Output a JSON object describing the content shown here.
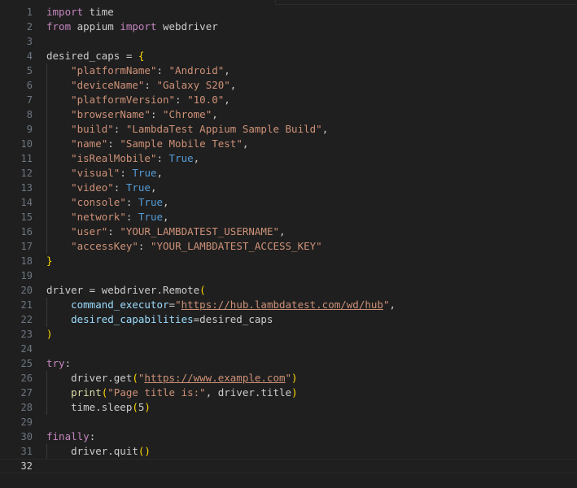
{
  "editor": {
    "current_line": 32,
    "lines": [
      {
        "n": "1",
        "tokens": [
          [
            "kw",
            "import"
          ],
          [
            "pl",
            " time"
          ]
        ]
      },
      {
        "n": "2",
        "tokens": [
          [
            "kw",
            "from"
          ],
          [
            "pl",
            " appium "
          ],
          [
            "kw",
            "import"
          ],
          [
            "pl",
            " webdriver"
          ]
        ]
      },
      {
        "n": "3",
        "tokens": []
      },
      {
        "n": "4",
        "tokens": [
          [
            "pl",
            "desired_caps = "
          ],
          [
            "br1",
            "{"
          ]
        ]
      },
      {
        "n": "5",
        "tokens": [
          [
            "pl",
            "    "
          ],
          [
            "str",
            "\"platformName\""
          ],
          [
            "pl",
            ": "
          ],
          [
            "str",
            "\"Android\""
          ],
          [
            "pl",
            ","
          ]
        ]
      },
      {
        "n": "6",
        "tokens": [
          [
            "pl",
            "    "
          ],
          [
            "str",
            "\"deviceName\""
          ],
          [
            "pl",
            ": "
          ],
          [
            "str",
            "\"Galaxy S20\""
          ],
          [
            "pl",
            ","
          ]
        ]
      },
      {
        "n": "7",
        "tokens": [
          [
            "pl",
            "    "
          ],
          [
            "str",
            "\"platformVersion\""
          ],
          [
            "pl",
            ": "
          ],
          [
            "str",
            "\"10.0\""
          ],
          [
            "pl",
            ","
          ]
        ]
      },
      {
        "n": "8",
        "tokens": [
          [
            "pl",
            "    "
          ],
          [
            "str",
            "\"browserName\""
          ],
          [
            "pl",
            ": "
          ],
          [
            "str",
            "\"Chrome\""
          ],
          [
            "pl",
            ","
          ]
        ]
      },
      {
        "n": "9",
        "tokens": [
          [
            "pl",
            "    "
          ],
          [
            "str",
            "\"build\""
          ],
          [
            "pl",
            ": "
          ],
          [
            "str",
            "\"LambdaTest Appium Sample Build\""
          ],
          [
            "pl",
            ","
          ]
        ]
      },
      {
        "n": "10",
        "tokens": [
          [
            "pl",
            "    "
          ],
          [
            "str",
            "\"name\""
          ],
          [
            "pl",
            ": "
          ],
          [
            "str",
            "\"Sample Mobile Test\""
          ],
          [
            "pl",
            ","
          ]
        ]
      },
      {
        "n": "11",
        "tokens": [
          [
            "pl",
            "    "
          ],
          [
            "str",
            "\"isRealMobile\""
          ],
          [
            "pl",
            ": "
          ],
          [
            "bool",
            "True"
          ],
          [
            "pl",
            ","
          ]
        ]
      },
      {
        "n": "12",
        "tokens": [
          [
            "pl",
            "    "
          ],
          [
            "str",
            "\"visual\""
          ],
          [
            "pl",
            ": "
          ],
          [
            "bool",
            "True"
          ],
          [
            "pl",
            ","
          ]
        ]
      },
      {
        "n": "13",
        "tokens": [
          [
            "pl",
            "    "
          ],
          [
            "str",
            "\"video\""
          ],
          [
            "pl",
            ": "
          ],
          [
            "bool",
            "True"
          ],
          [
            "pl",
            ","
          ]
        ]
      },
      {
        "n": "14",
        "tokens": [
          [
            "pl",
            "    "
          ],
          [
            "str",
            "\"console\""
          ],
          [
            "pl",
            ": "
          ],
          [
            "bool",
            "True"
          ],
          [
            "pl",
            ","
          ]
        ]
      },
      {
        "n": "15",
        "tokens": [
          [
            "pl",
            "    "
          ],
          [
            "str",
            "\"network\""
          ],
          [
            "pl",
            ": "
          ],
          [
            "bool",
            "True"
          ],
          [
            "pl",
            ","
          ]
        ]
      },
      {
        "n": "16",
        "tokens": [
          [
            "pl",
            "    "
          ],
          [
            "str",
            "\"user\""
          ],
          [
            "pl",
            ": "
          ],
          [
            "str",
            "\"YOUR_LAMBDATEST_USERNAME\""
          ],
          [
            "pl",
            ","
          ]
        ]
      },
      {
        "n": "17",
        "tokens": [
          [
            "pl",
            "    "
          ],
          [
            "str",
            "\"accessKey\""
          ],
          [
            "pl",
            ": "
          ],
          [
            "str",
            "\"YOUR_LAMBDATEST_ACCESS_KEY\""
          ]
        ]
      },
      {
        "n": "18",
        "tokens": [
          [
            "br1",
            "}"
          ]
        ]
      },
      {
        "n": "19",
        "tokens": []
      },
      {
        "n": "20",
        "tokens": [
          [
            "pl",
            "driver = webdriver.Remote"
          ],
          [
            "br1",
            "("
          ]
        ]
      },
      {
        "n": "21",
        "tokens": [
          [
            "pl",
            "    "
          ],
          [
            "var",
            "command_executor"
          ],
          [
            "pl",
            "="
          ],
          [
            "str",
            "\""
          ],
          [
            "str link",
            "https://hub.lambdatest.com/wd/hub"
          ],
          [
            "str",
            "\""
          ],
          [
            "pl",
            ","
          ]
        ]
      },
      {
        "n": "22",
        "tokens": [
          [
            "pl",
            "    "
          ],
          [
            "var",
            "desired_capabilities"
          ],
          [
            "pl",
            "=desired_caps"
          ]
        ]
      },
      {
        "n": "23",
        "tokens": [
          [
            "br1",
            ")"
          ]
        ]
      },
      {
        "n": "24",
        "tokens": []
      },
      {
        "n": "25",
        "tokens": [
          [
            "kw",
            "try"
          ],
          [
            "pl",
            ":"
          ]
        ]
      },
      {
        "n": "26",
        "tokens": [
          [
            "pl",
            "    driver.get"
          ],
          [
            "br1",
            "("
          ],
          [
            "str",
            "\""
          ],
          [
            "str link",
            "https://www.example.com"
          ],
          [
            "str",
            "\""
          ],
          [
            "br1",
            ")"
          ]
        ]
      },
      {
        "n": "27",
        "tokens": [
          [
            "pl",
            "    "
          ],
          [
            "fn",
            "print"
          ],
          [
            "br1",
            "("
          ],
          [
            "str",
            "\"Page title is:\""
          ],
          [
            "pl",
            ", driver.title"
          ],
          [
            "br1",
            ")"
          ]
        ]
      },
      {
        "n": "28",
        "tokens": [
          [
            "pl",
            "    time.sleep"
          ],
          [
            "br1",
            "("
          ],
          [
            "pl",
            "5"
          ],
          [
            "br1",
            ")"
          ]
        ]
      },
      {
        "n": "29",
        "tokens": []
      },
      {
        "n": "30",
        "tokens": [
          [
            "kw",
            "finally"
          ],
          [
            "pl",
            ":"
          ]
        ]
      },
      {
        "n": "31",
        "tokens": [
          [
            "pl",
            "    driver.quit"
          ],
          [
            "br1",
            "("
          ],
          [
            "br1",
            ")"
          ]
        ]
      },
      {
        "n": "32",
        "tokens": []
      }
    ]
  }
}
